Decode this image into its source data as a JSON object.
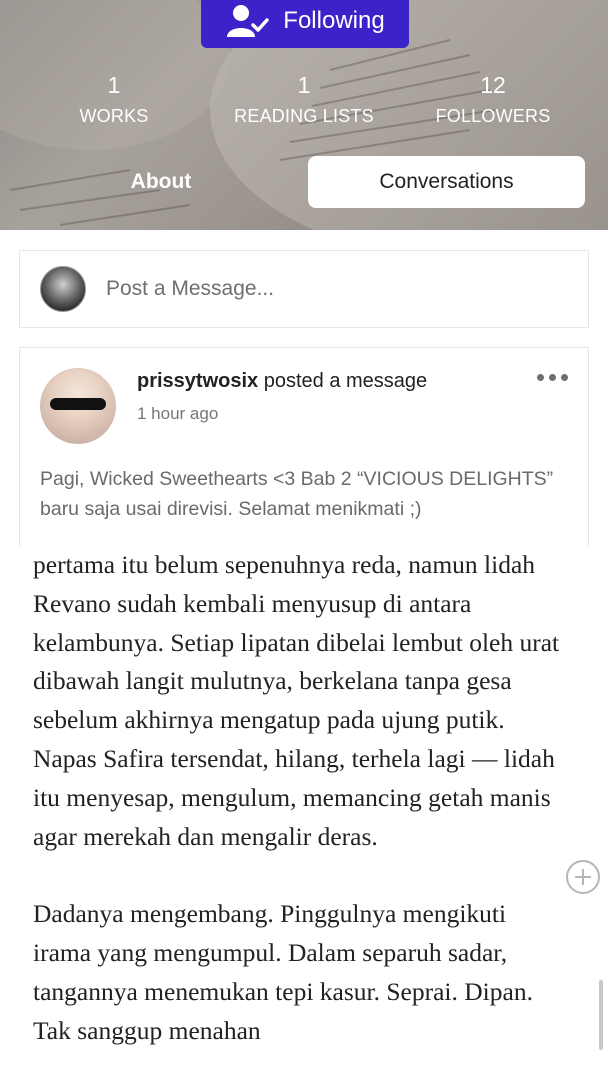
{
  "header": {
    "follow_label": "Following",
    "stats": [
      {
        "value": "1",
        "label": "WORKS"
      },
      {
        "value": "1",
        "label": "READING LISTS"
      },
      {
        "value": "12",
        "label": "FOLLOWERS"
      }
    ],
    "tabs": {
      "about": "About",
      "conversations": "Conversations"
    }
  },
  "composer": {
    "placeholder": "Post a Message..."
  },
  "message": {
    "author": "prissytwosix",
    "action": " posted a message",
    "time": "1 hour ago",
    "text": "Pagi, Wicked Sweethearts <3 Bab 2 “VICIOUS DELIGHTS” baru saja usai direvisi. Selamat menikmati ;)"
  },
  "story": {
    "paragraphs": [
      "pertama itu belum sepenuhnya reda, namun lidah Revano sudah kembali menyusup di antara kelambunya. Setiap lipatan dibelai lembut oleh urat dibawah langit mulutnya, berkelana tanpa gesa sebelum akhirnya mengatup pada ujung putik. Napas Safira tersendat, hilang, terhela lagi — lidah itu menyesap, mengulum, memancing getah manis agar merekah dan mengalir deras.",
      "Dadanya mengembang. Pinggulnya mengikuti irama yang mengumpul. Dalam separuh sadar, tangannya menemukan tepi kasur. Seprai. Dipan. Tak sanggup menahan"
    ]
  },
  "icons": {
    "follow": "user-check-icon",
    "more": "more-horizontal-icon",
    "add": "plus-circle-icon"
  },
  "colors": {
    "accent": "#3b23c9"
  }
}
